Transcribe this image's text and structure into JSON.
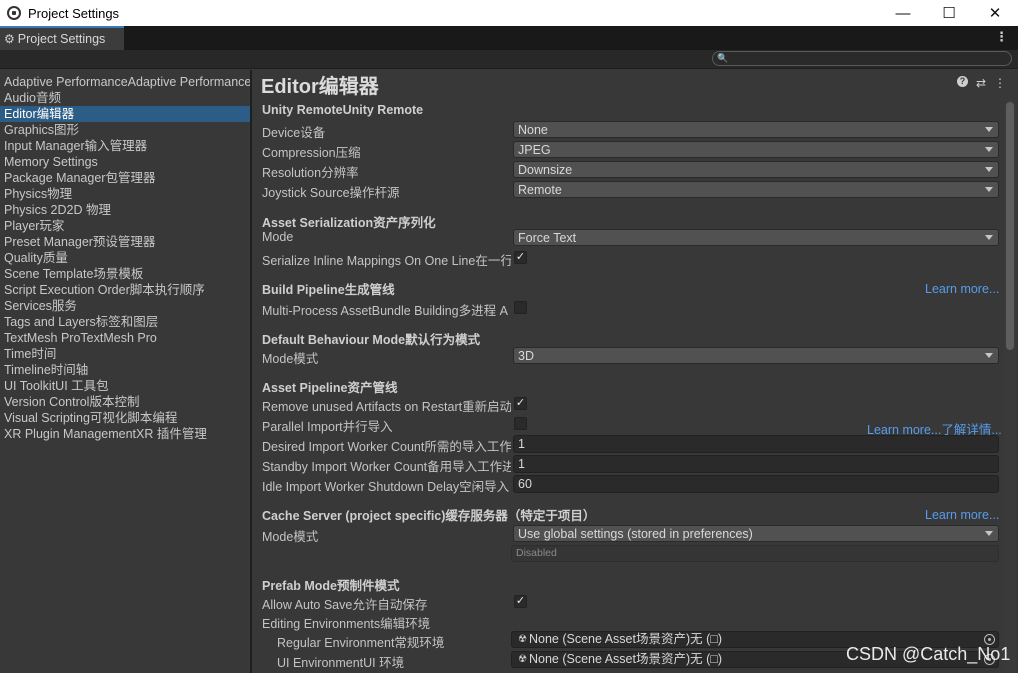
{
  "window": {
    "title": "Project Settings",
    "minimize": "—",
    "maximize": "☐",
    "close": "✕"
  },
  "tab": {
    "label": "Project Settings",
    "menu": "⋮"
  },
  "search": {
    "value": "",
    "placeholder": ""
  },
  "sidebar": {
    "items": [
      {
        "label": "Adaptive PerformanceAdaptive Performance"
      },
      {
        "label": "Audio音频"
      },
      {
        "label": "Editor编辑器"
      },
      {
        "label": "Graphics图形"
      },
      {
        "label": "Input Manager输入管理器"
      },
      {
        "label": "Memory Settings"
      },
      {
        "label": "Package Manager包管理器"
      },
      {
        "label": "Physics物理"
      },
      {
        "label": "Physics 2D2D 物理"
      },
      {
        "label": "Player玩家"
      },
      {
        "label": "Preset Manager预设管理器"
      },
      {
        "label": "Quality质量"
      },
      {
        "label": "Scene Template场景模板"
      },
      {
        "label": "Script Execution Order脚本执行顺序"
      },
      {
        "label": "Services服务"
      },
      {
        "label": "Tags and Layers标签和图层"
      },
      {
        "label": "TextMesh ProTextMesh Pro"
      },
      {
        "label": "Time时间"
      },
      {
        "label": "Timeline时间轴"
      },
      {
        "label": "UI ToolkitUI 工具包"
      },
      {
        "label": "Version Control版本控制"
      },
      {
        "label": "Visual Scripting可视化脚本编程"
      },
      {
        "label": "XR Plugin ManagementXR 插件管理"
      }
    ],
    "active_index": 2
  },
  "main": {
    "title": "Editor编辑器",
    "header_icons": {
      "help": "?",
      "presets": "⇄",
      "menu": "⋮"
    },
    "unity_remote": {
      "heading": "Unity RemoteUnity Remote",
      "device_label": "Device设备",
      "device_value": "None",
      "compression_label": "Compression压缩",
      "compression_value": "JPEG",
      "resolution_label": "Resolution分辨率",
      "resolution_value": "Downsize",
      "joystick_label": "Joystick Source操作杆源",
      "joystick_value": "Remote"
    },
    "asset_serialization": {
      "heading": "Asset Serialization资产序列化",
      "mode_label": "Mode",
      "mode_value": "Force Text",
      "inline_label": "Serialize Inline Mappings On One Line在一行",
      "inline_checked": "✓"
    },
    "build_pipeline": {
      "heading": "Build Pipeline生成管线",
      "learn_more": "Learn more...",
      "multiprocess_label": "Multi-Process AssetBundle Building多进程 A",
      "multiprocess_checked": ""
    },
    "default_behaviour": {
      "heading": "Default Behaviour Mode默认行为模式",
      "mode_label": "Mode模式",
      "mode_value": "3D"
    },
    "asset_pipeline": {
      "heading": "Asset Pipeline资产管线",
      "remove_unused_label": "Remove unused Artifacts on Restart重新启动",
      "remove_unused_checked": "✓",
      "parallel_import_label": "Parallel Import并行导入",
      "parallel_import_checked": "",
      "learn_more": "Learn more...了解详情...",
      "desired_workers_label": "Desired Import Worker Count所需的导入工作",
      "desired_workers_value": "1",
      "standby_workers_label": "Standby Import Worker Count备用导入工作进",
      "standby_workers_value": "1",
      "idle_shutdown_label": "Idle Import Worker Shutdown Delay空闲导入",
      "idle_shutdown_value": "60"
    },
    "cache_server": {
      "heading": "Cache Server (project specific)缓存服务器（特定于项目）",
      "learn_more": "Learn more...",
      "mode_label": "Mode模式",
      "mode_value": "Use global settings (stored in preferences)",
      "status_value": "Disabled"
    },
    "prefab_mode": {
      "heading": "Prefab Mode预制件模式",
      "autosave_label": "Allow Auto Save允许自动保存",
      "autosave_checked": "✓",
      "editing_env_label": "Editing Environments编辑环境",
      "regular_env_label": "Regular Environment常规环境",
      "regular_env_value": "None (Scene Asset场景资产)无 (□)",
      "ui_env_label": "UI EnvironmentUI 环境",
      "ui_env_value": "None (Scene Asset场景资产)无 (□)"
    }
  },
  "watermark": "CSDN @Catch_No1",
  "colors": {
    "background": "#383838",
    "selection": "#2c5d87",
    "link": "#589ced",
    "tab_accent": "#3a79bb"
  }
}
